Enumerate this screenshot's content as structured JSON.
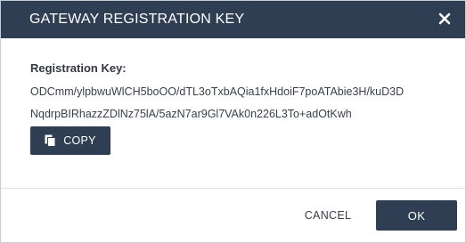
{
  "dialog": {
    "title": "GATEWAY REGISTRATION KEY",
    "close_icon": "close-icon"
  },
  "content": {
    "label": "Registration Key:",
    "key_lines": [
      "ODCmm/ylpbwuWlCH5boOO/dTL3oTxbAQia1fxHdoiF7poATAbie3H/kuD3D",
      "NqdrpBIRhazzZDlNz75lA/5azN7ar9Gl7VAk0n226L3To+adOtKwh"
    ],
    "copy_button": {
      "label": "COPY",
      "icon": "copy-icon"
    }
  },
  "footer": {
    "cancel_label": "CANCEL",
    "ok_label": "OK"
  },
  "colors": {
    "header_bg": "#2f3e52",
    "button_bg": "#2f3e52",
    "text": "#3a3f47"
  }
}
